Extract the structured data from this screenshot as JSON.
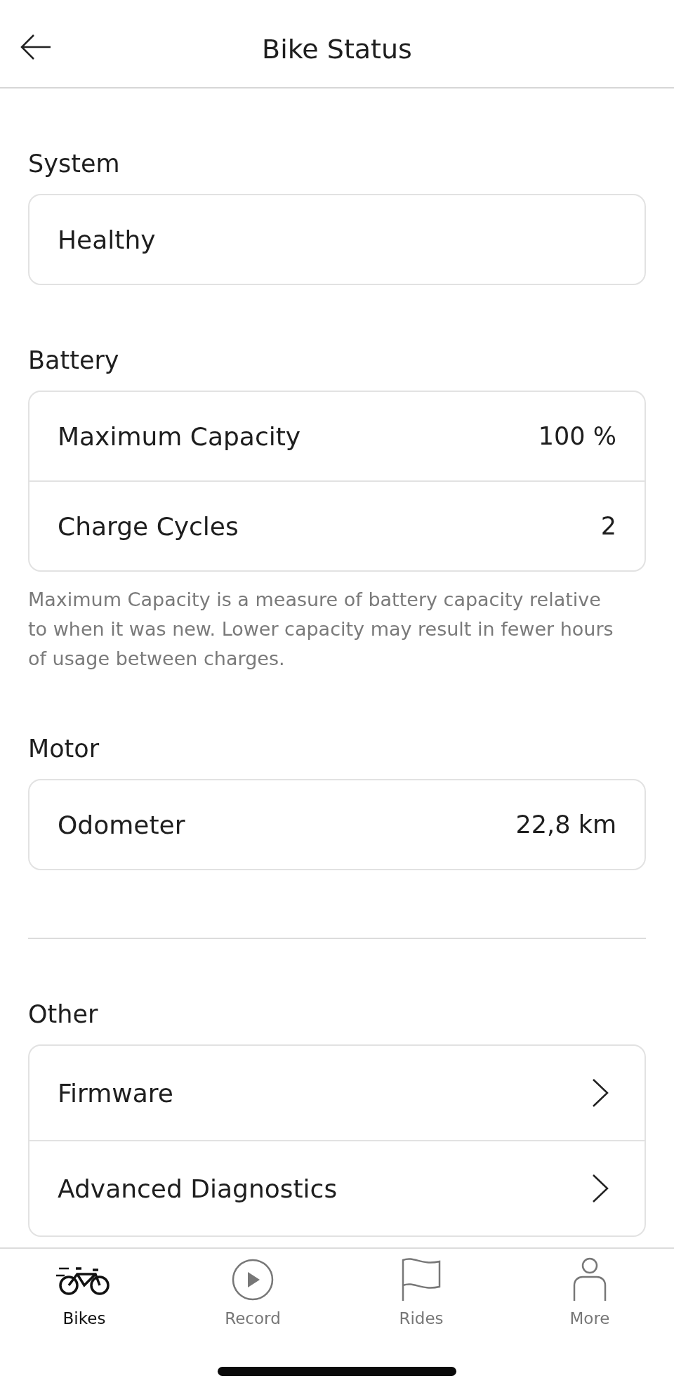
{
  "header": {
    "title": "Bike Status"
  },
  "sections": [
    {
      "heading": "System",
      "rows": [
        {
          "kind": "text",
          "label": "Healthy"
        }
      ]
    },
    {
      "heading": "Battery",
      "rows": [
        {
          "kind": "value",
          "label": "Maximum Capacity",
          "value": "100 %"
        },
        {
          "kind": "value",
          "label": "Charge Cycles",
          "value": "2"
        }
      ],
      "note": "Maximum Capacity is a measure of battery capacity relative to when it was new. Lower capacity may result in fewer hours of usage between charges."
    },
    {
      "heading": "Motor",
      "rows": [
        {
          "kind": "value",
          "label": "Odometer",
          "value": "22,8 km"
        }
      ],
      "divider_after": true
    },
    {
      "heading": "Other",
      "rows": [
        {
          "kind": "link",
          "label": "Firmware"
        },
        {
          "kind": "link",
          "label": "Advanced Diagnostics"
        }
      ]
    }
  ],
  "tabs": [
    {
      "kind": "bike",
      "label": "Bikes",
      "selected": true
    },
    {
      "kind": "record",
      "label": "Record",
      "selected": false
    },
    {
      "kind": "flag",
      "label": "Rides",
      "selected": false
    },
    {
      "kind": "person",
      "label": "More",
      "selected": false
    }
  ]
}
